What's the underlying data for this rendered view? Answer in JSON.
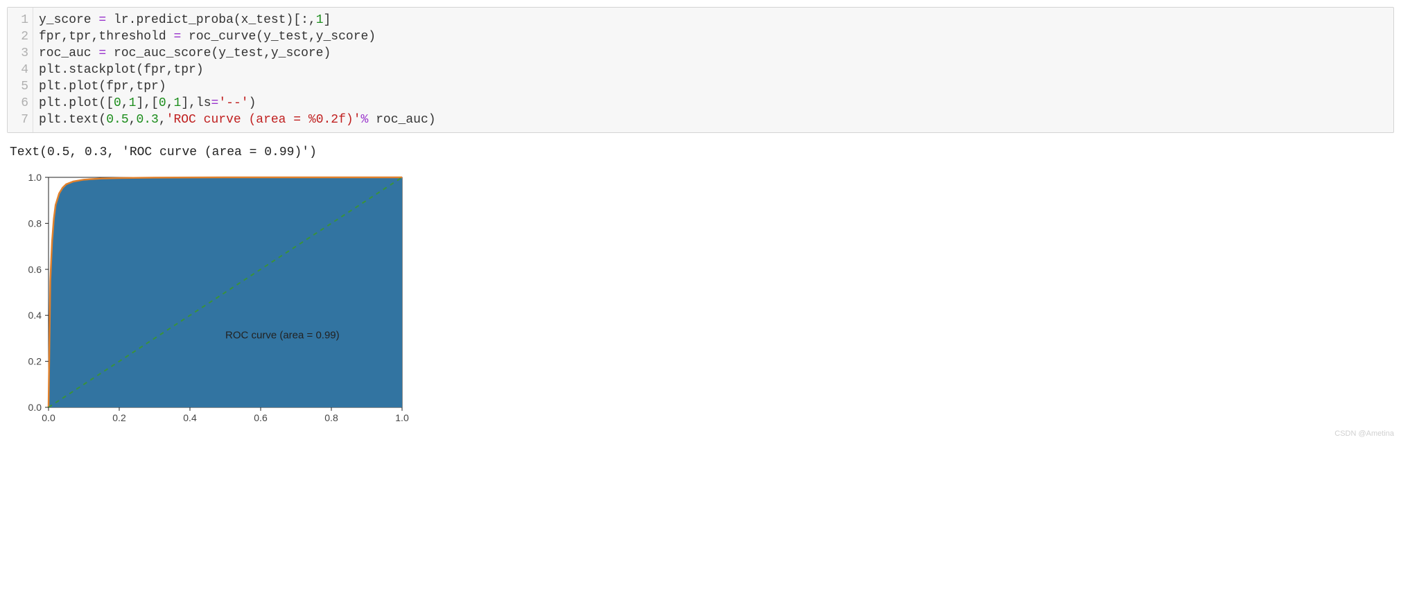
{
  "code": {
    "lines": [
      "1",
      "2",
      "3",
      "4",
      "5",
      "6",
      "7"
    ],
    "l1": {
      "a": "y_score ",
      "b": "=",
      "c": " lr.predict_proba(x_test)[:,",
      "d": "1",
      "e": "]"
    },
    "l2": {
      "a": "fpr,tpr,threshold ",
      "b": "=",
      "c": " roc_curve(y_test,y_score)"
    },
    "l3": {
      "a": "roc_auc ",
      "b": "=",
      "c": " roc_auc_score(y_test,y_score)"
    },
    "l4": {
      "a": "plt.stackplot(fpr,tpr)"
    },
    "l5": {
      "a": "plt.plot(fpr,tpr)"
    },
    "l6": {
      "a": "plt.plot([",
      "b": "0",
      "c": ",",
      "d": "1",
      "e": "],[",
      "f": "0",
      "g": ",",
      "h": "1",
      "i": "],ls",
      "j": "=",
      "k": "'--'",
      "l": ")"
    },
    "l7": {
      "a": "plt.text(",
      "b": "0.5",
      "c": ",",
      "d": "0.3",
      "e": ",",
      "f": "'ROC curve (area = %0.2f)'",
      "g": "%",
      "h": " roc_auc)"
    }
  },
  "output_line": "Text(0.5, 0.3, 'ROC curve (area = 0.99)')",
  "watermark": "CSDN @Ametina",
  "chart_data": {
    "type": "area",
    "x": [
      0.0,
      0.005,
      0.01,
      0.015,
      0.02,
      0.03,
      0.04,
      0.05,
      0.07,
      0.1,
      0.15,
      0.2,
      0.3,
      0.5,
      0.7,
      0.9,
      1.0
    ],
    "roc_y": [
      0.0,
      0.55,
      0.72,
      0.82,
      0.88,
      0.93,
      0.955,
      0.97,
      0.982,
      0.99,
      0.995,
      0.997,
      0.999,
      1.0,
      1.0,
      1.0,
      1.0
    ],
    "diag": {
      "x": [
        0.0,
        1.0
      ],
      "y": [
        0.0,
        1.0
      ]
    },
    "annotation": "ROC curve (area = 0.99)",
    "xticks": [
      "0.0",
      "0.2",
      "0.4",
      "0.6",
      "0.8",
      "1.0"
    ],
    "yticks": [
      "0.0",
      "0.2",
      "0.4",
      "0.6",
      "0.8",
      "1.0"
    ],
    "xlim": [
      0.0,
      1.0
    ],
    "ylim": [
      0.0,
      1.0
    ]
  }
}
